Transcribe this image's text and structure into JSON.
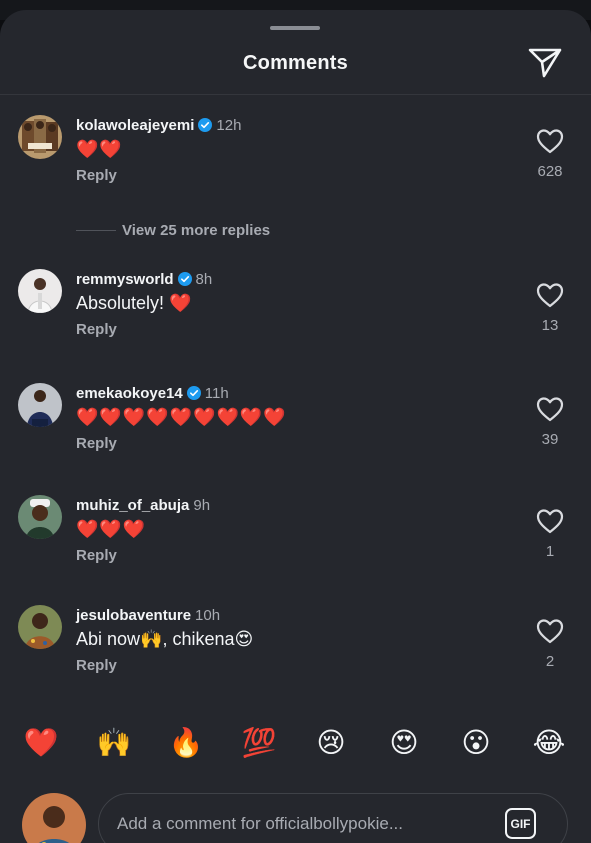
{
  "header": {
    "title": "Comments"
  },
  "icons": {
    "share": "paper-plane-icon",
    "like": "heart-outline-icon",
    "verified": "verified-badge-icon"
  },
  "colors": {
    "sheet": "#25272d",
    "heart": "#e8132d",
    "verified": "#1d9bf0",
    "muted": "#a8abb2"
  },
  "comments": [
    {
      "username": "kolawoleajeyemi",
      "verified": true,
      "time": "12h",
      "text": "",
      "emoji": "❤️❤️",
      "reply": "Reply",
      "likes": "628"
    },
    {
      "username": "remmysworld",
      "verified": true,
      "time": "8h",
      "text": "Absolutely! ",
      "emoji": "❤️",
      "reply": "Reply",
      "likes": "13"
    },
    {
      "username": "emekaokoye14",
      "verified": true,
      "time": "11h",
      "text": "",
      "emoji": "❤️❤️❤️❤️❤️❤️❤️❤️❤️",
      "reply": "Reply",
      "likes": "39"
    },
    {
      "username": "muhiz_of_abuja",
      "verified": false,
      "time": "9h",
      "text": "",
      "emoji": "❤️❤️❤️",
      "reply": "Reply",
      "likes": "1"
    },
    {
      "username": "jesulobaventure",
      "verified": false,
      "time": "10h",
      "text": "Abi now🙌, chikena😍",
      "emoji": "",
      "reply": "Reply",
      "likes": "2"
    }
  ],
  "more_replies": "View 25 more replies",
  "reactions": [
    "❤️",
    "🙌",
    "🔥",
    "💯",
    "😢",
    "😍",
    "😮",
    "😂"
  ],
  "composer": {
    "placeholder": "Add a comment for officialbollypokie...",
    "gif_label": "GIF"
  }
}
